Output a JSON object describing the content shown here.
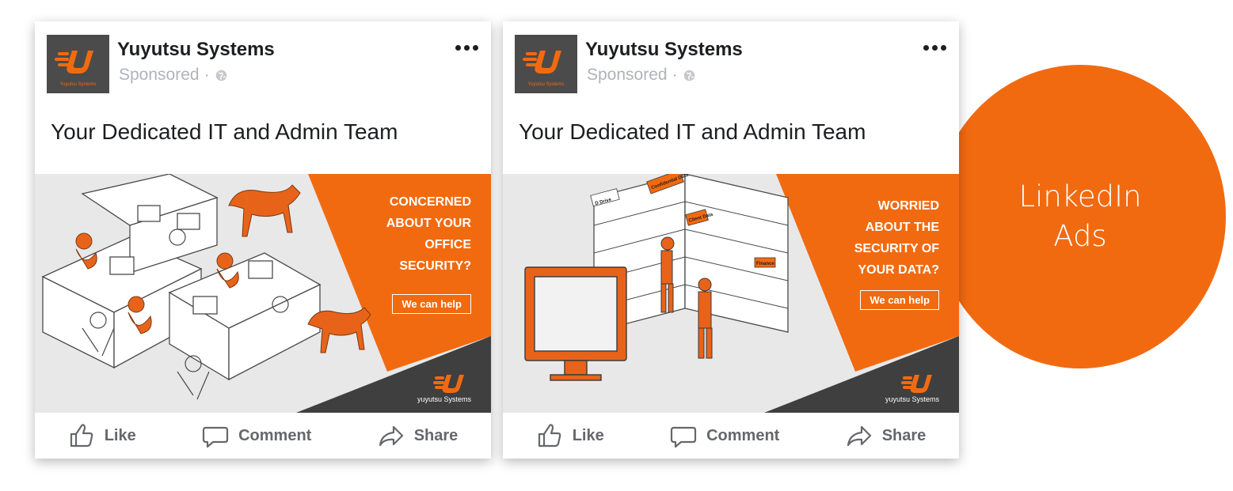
{
  "side_badge": {
    "line1": "LinkedIn",
    "line2": "Ads",
    "color": "#f26a10"
  },
  "cards": [
    {
      "brand": "Yuyutsu Systems",
      "logo_caption": "Yuyutsu Systems",
      "sponsored": "Sponsored",
      "sponsored_separator": "·",
      "headline": "Your Dedicated IT and Admin Team",
      "ad_text": "CONCERNED\nABOUT YOUR\nOFFICE\nSECURITY?",
      "ad_button": "We can help",
      "ad_logo_text": "yuyutsu Systems",
      "actions": {
        "like": "Like",
        "comment": "Comment",
        "share": "Share"
      }
    },
    {
      "brand": "Yuyutsu Systems",
      "logo_caption": "Yuyutsu Systems",
      "sponsored": "Sponsored",
      "sponsored_separator": "·",
      "headline": "Your Dedicated IT and Admin Team",
      "ad_text": "WORRIED\nABOUT THE\nSECURITY OF\nYOUR DATA?",
      "ad_button": "We can help",
      "ad_logo_text": "yuyutsu Systems",
      "illustration_labels": {
        "drive": "D Drive",
        "confidential": "Confidential Data",
        "client": "Client Data",
        "finance": "Finance"
      },
      "actions": {
        "like": "Like",
        "comment": "Comment",
        "share": "Share"
      }
    }
  ],
  "colors": {
    "accent": "#f26a10",
    "dark_panel": "#3f3f40",
    "logo_bg": "#4b4b4b",
    "muted_text": "#65676b",
    "sponsored_text": "#b0b3b8"
  },
  "icons": [
    "more-options-icon",
    "globe-icon",
    "like-icon",
    "comment-icon",
    "share-icon",
    "brand-logo-icon"
  ]
}
